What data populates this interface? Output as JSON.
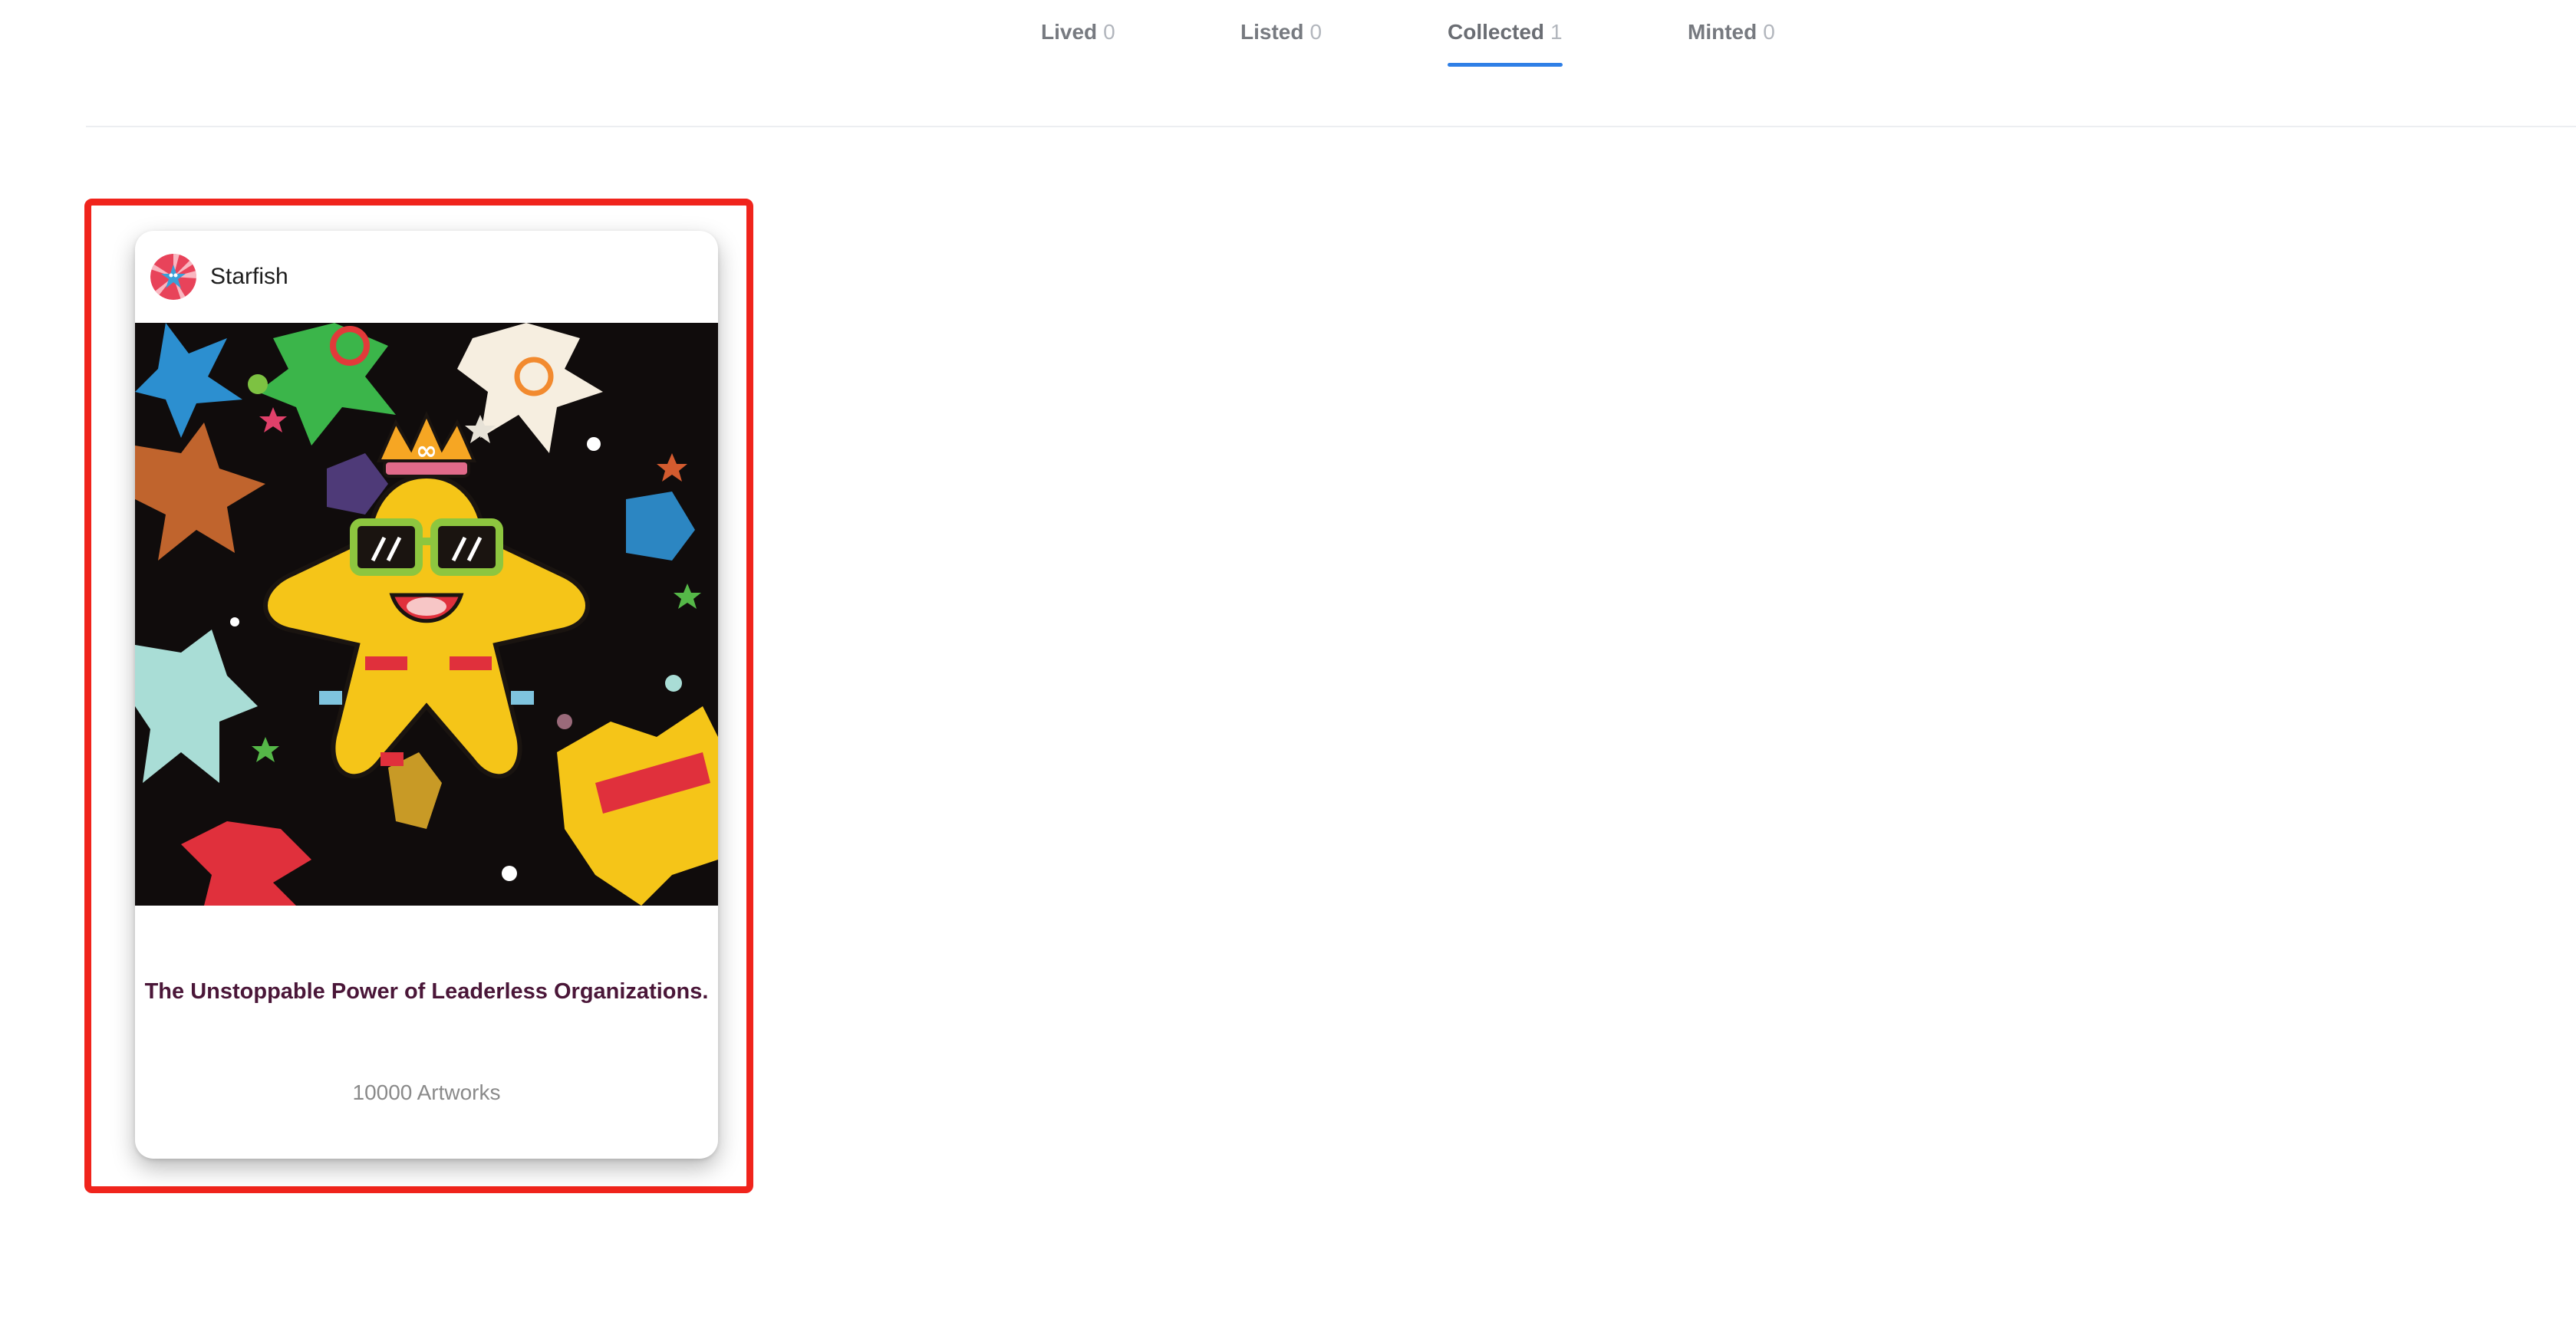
{
  "tabs": [
    {
      "name": "Lived",
      "count": "0",
      "active": false
    },
    {
      "name": "Listed",
      "count": "0",
      "active": false
    },
    {
      "name": "Collected",
      "count": "1",
      "active": true
    },
    {
      "name": "Minted",
      "count": "0",
      "active": false
    }
  ],
  "colors": {
    "active_tab_underline": "#2f7fe6",
    "highlight_border": "#f0241c",
    "card_title": "#4a1638",
    "artwork_background": "#100c0c",
    "main_character": "#f5c518"
  },
  "card": {
    "collection_name": "Starfish",
    "avatar_icon": "starfish-avatar-icon",
    "image_icon": "starfish-artwork-image",
    "title": "The Unstoppable Power of Leaderless Organizations.",
    "artworks_count": "10000 Artworks"
  }
}
